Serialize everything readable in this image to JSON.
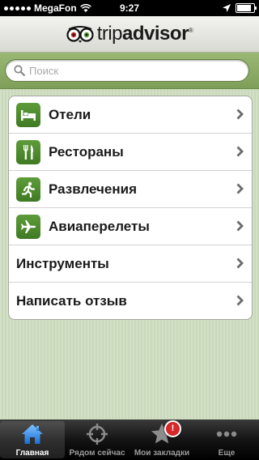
{
  "status_bar": {
    "carrier": "MegaFon",
    "time": "9:27"
  },
  "header": {
    "logo_text_prefix": "trip",
    "logo_text_main": "advisor",
    "logo_reg": "®"
  },
  "search": {
    "placeholder": "Поиск",
    "value": ""
  },
  "menu": {
    "items": [
      {
        "label": "Отели",
        "icon": "bed-icon"
      },
      {
        "label": "Рестораны",
        "icon": "fork-knife-icon"
      },
      {
        "label": "Развлечения",
        "icon": "running-person-icon"
      },
      {
        "label": "Авиаперелеты",
        "icon": "airplane-icon"
      },
      {
        "label": "Инструменты",
        "icon": ""
      },
      {
        "label": "Написать отзыв",
        "icon": ""
      }
    ]
  },
  "tabbar": {
    "tabs": [
      {
        "label": "Главная",
        "icon": "home-icon",
        "active": true
      },
      {
        "label": "Рядом сейчас",
        "icon": "crosshair-icon",
        "active": false
      },
      {
        "label": "Мои закладки",
        "icon": "star-icon",
        "active": false,
        "badge": "!"
      },
      {
        "label": "Еще",
        "icon": "more-dots-icon",
        "active": false
      }
    ]
  },
  "colors": {
    "accent_green": "#4f8a2d",
    "search_bar_green": "#8aab66",
    "badge_red": "#d4282b"
  }
}
